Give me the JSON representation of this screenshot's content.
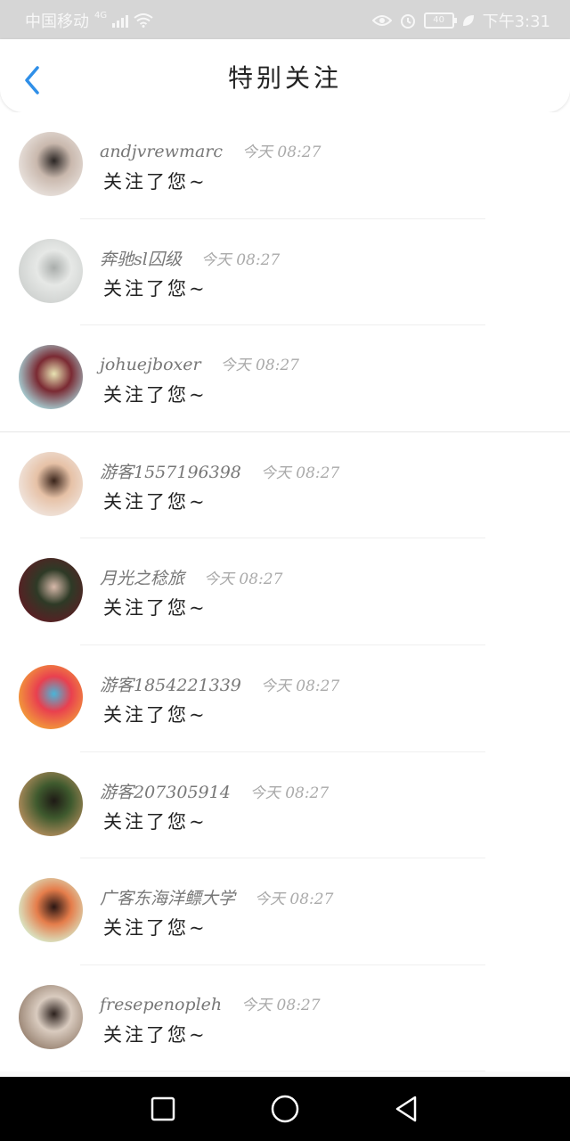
{
  "status_bar": {
    "carrier": "中国移动",
    "network": "4G",
    "battery": "40",
    "time": "下午3:31"
  },
  "header": {
    "title": "特别关注",
    "back_icon": "chevron-left-icon"
  },
  "list": {
    "items": [
      {
        "username": "andjvrewmarc",
        "time": "今天 08:27",
        "message": "关注了您~",
        "avatar_colors": [
          "#e8e1dc",
          "#2b2624",
          "#c9b8ad"
        ]
      },
      {
        "username": "奔驰sl囚级",
        "time": "今天 08:27",
        "message": "关注了您~",
        "avatar_colors": [
          "#cfd2d0",
          "#a9adab",
          "#e6e8e6"
        ]
      },
      {
        "username": "johuejboxer",
        "time": "今天 08:27",
        "message": "关注了您~",
        "avatar_colors": [
          "#a7d1d6",
          "#e8e3b3",
          "#7a2a33"
        ]
      },
      {
        "username": "游客1557196398",
        "time": "今天 08:27",
        "message": "关注了您~",
        "avatar_colors": [
          "#f0e4dc",
          "#3a241a",
          "#e6c1a6"
        ]
      },
      {
        "username": "月光之稔旅",
        "time": "今天 08:27",
        "message": "关注了您~",
        "avatar_colors": [
          "#5a1f24",
          "#d7b9aa",
          "#2e3a26"
        ]
      },
      {
        "username": "游客1854221339",
        "time": "今天 08:27",
        "message": "关注了您~",
        "avatar_colors": [
          "#f29b3a",
          "#49b5d8",
          "#e9404f"
        ]
      },
      {
        "username": "游客207305914",
        "time": "今天 08:27",
        "message": "关注了您~",
        "avatar_colors": [
          "#b08c5c",
          "#1e1a15",
          "#3f5a2e"
        ]
      },
      {
        "username": "广客东海洋鳔大学",
        "time": "今天 08:27",
        "message": "关注了您~",
        "avatar_colors": [
          "#d9e8c7",
          "#2b1613",
          "#e57d4b"
        ]
      },
      {
        "username": "fresepenopleh",
        "time": "今天 08:27",
        "message": "关注了您~",
        "avatar_colors": [
          "#9a8574",
          "#2c211d",
          "#d9cbbf"
        ]
      }
    ]
  },
  "nav_bar": {
    "recent_icon": "square-icon",
    "home_icon": "circle-icon",
    "back_icon": "triangle-back-icon"
  }
}
